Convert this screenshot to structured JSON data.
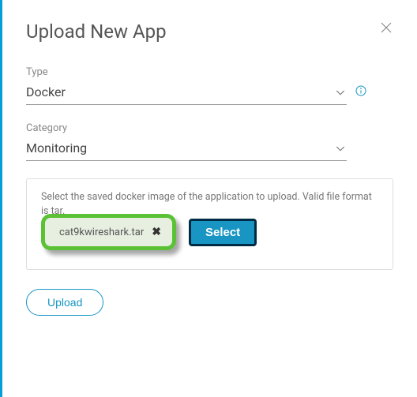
{
  "title": "Upload New App",
  "fields": {
    "type": {
      "label": "Type",
      "value": "Docker"
    },
    "category": {
      "label": "Category",
      "value": "Monitoring"
    }
  },
  "upload": {
    "helper": "Select the saved docker image of the application to upload. Valid file format is tar.",
    "file_name": "cat9kwireshark.tar",
    "select_label": "Select"
  },
  "buttons": {
    "upload": "Upload"
  }
}
